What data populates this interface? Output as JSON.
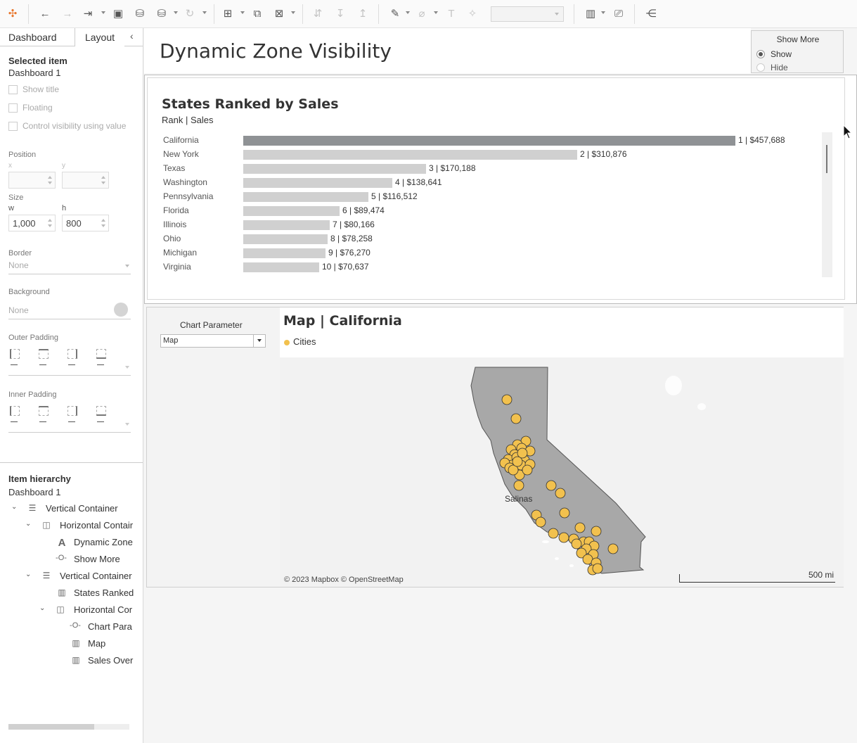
{
  "toolbar": {
    "icons": [
      "tableau-logo-icon",
      "undo-icon",
      "redo-icon",
      "replay-icon",
      "save-icon",
      "new-datasource-icon",
      "pause-updates-icon",
      "refresh-icon",
      "new-worksheet-icon",
      "duplicate-icon",
      "clear-icon",
      "swap-icon",
      "sort-ascending-icon",
      "sort-descending-icon",
      "highlight-icon",
      "group-icon",
      "label-icon",
      "fix-axes-icon",
      "show-me-icon",
      "presentation-icon",
      "share-icon"
    ],
    "fit_value": ""
  },
  "tabs": {
    "dashboard": "Dashboard",
    "layout": "Layout"
  },
  "selected": {
    "title": "Selected item",
    "item": "Dashboard 1",
    "show_title": "Show title",
    "floating": "Floating",
    "control_visibility": "Control visibility using value"
  },
  "position": {
    "label": "Position",
    "x_label": "x",
    "y_label": "y",
    "x": "",
    "y": ""
  },
  "size": {
    "label": "Size",
    "w_label": "w",
    "h_label": "h",
    "w": "1,000",
    "h": "800"
  },
  "border": {
    "label": "Border",
    "value": "None"
  },
  "background": {
    "label": "Background",
    "value": "None",
    "color": "#d4d4d4"
  },
  "outer_padding": {
    "label": "Outer Padding"
  },
  "inner_padding": {
    "label": "Inner Padding"
  },
  "hierarchy": {
    "title": "Item hierarchy",
    "root": "Dashboard 1",
    "items": [
      {
        "label": "Vertical Container",
        "icon": "vertical-container-icon"
      },
      {
        "label": "Horizontal Contair",
        "icon": "horizontal-container-icon"
      },
      {
        "label": "Dynamic Zone",
        "icon": "text-icon"
      },
      {
        "label": "Show More",
        "icon": "parameter-icon"
      },
      {
        "label": "Vertical Container",
        "icon": "vertical-container-icon"
      },
      {
        "label": "States Ranked",
        "icon": "sheet-icon"
      },
      {
        "label": "Horizontal Cor",
        "icon": "horizontal-container-icon"
      },
      {
        "label": "Chart Para",
        "icon": "parameter-icon"
      },
      {
        "label": "Map",
        "icon": "sheet-icon"
      },
      {
        "label": "Sales Over",
        "icon": "sheet-icon"
      }
    ]
  },
  "dashboard": {
    "title": "Dynamic Zone Visibility",
    "show_more": {
      "title": "Show More",
      "options": [
        "Show",
        "Hide"
      ],
      "selected": "Show"
    },
    "states_chart": {
      "title": "States Ranked by Sales",
      "subtitle": "Rank | Sales"
    },
    "chart_parameter": {
      "label": "Chart Parameter",
      "value": "Map"
    },
    "map": {
      "title": "Map | California",
      "legend": "Cities",
      "label": "Salinas",
      "credit": "© 2023 Mapbox © OpenStreetMap",
      "scale": "500 mi",
      "point_color": "#f2c14e",
      "state_color": "#a8a8a8"
    }
  },
  "chart_data": {
    "type": "bar",
    "title": "States Ranked by Sales",
    "subtitle": "Rank | Sales",
    "categories": [
      "California",
      "New York",
      "Texas",
      "Washington",
      "Pennsylvania",
      "Florida",
      "Illinois",
      "Ohio",
      "Michigan",
      "Virginia"
    ],
    "values": [
      457688,
      310876,
      170188,
      138641,
      116512,
      89474,
      80166,
      78258,
      76270,
      70637
    ],
    "labels": [
      "1 | $457,688",
      "2 | $310,876",
      "3 | $170,188",
      "4 | $138,641",
      "5 | $116,512",
      "6 | $89,474",
      "7 | $80,166",
      "8 | $78,258",
      "9 | $76,270",
      "10 | $70,637"
    ],
    "highlight": "California",
    "bar_color": "#d0d0d0",
    "highlight_color": "#8f9295"
  }
}
